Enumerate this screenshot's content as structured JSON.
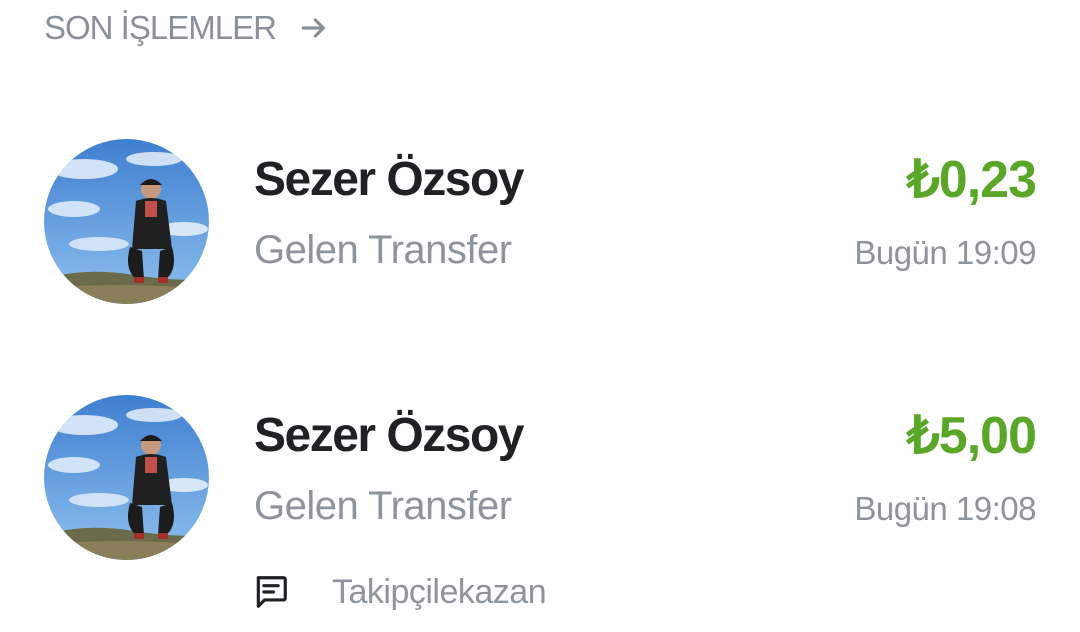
{
  "section": {
    "title": "SON İŞLEMLER",
    "arrow_icon": "arrow-right-icon"
  },
  "accent": {
    "amount_color": "#5aa628",
    "title_color": "#1f2124",
    "muted_color": "#8e949b"
  },
  "transactions": [
    {
      "name": "Sezer Özsoy",
      "type": "Gelen Transfer",
      "amount": "₺0,23",
      "time": "Bugün 19:09",
      "avatar_icon": "avatar"
    },
    {
      "name": "Sezer Özsoy",
      "type": "Gelen Transfer",
      "amount": "₺5,00",
      "time": "Bugün 19:08",
      "avatar_icon": "avatar",
      "note": "Takipçilekazan",
      "note_icon": "message-icon"
    }
  ]
}
